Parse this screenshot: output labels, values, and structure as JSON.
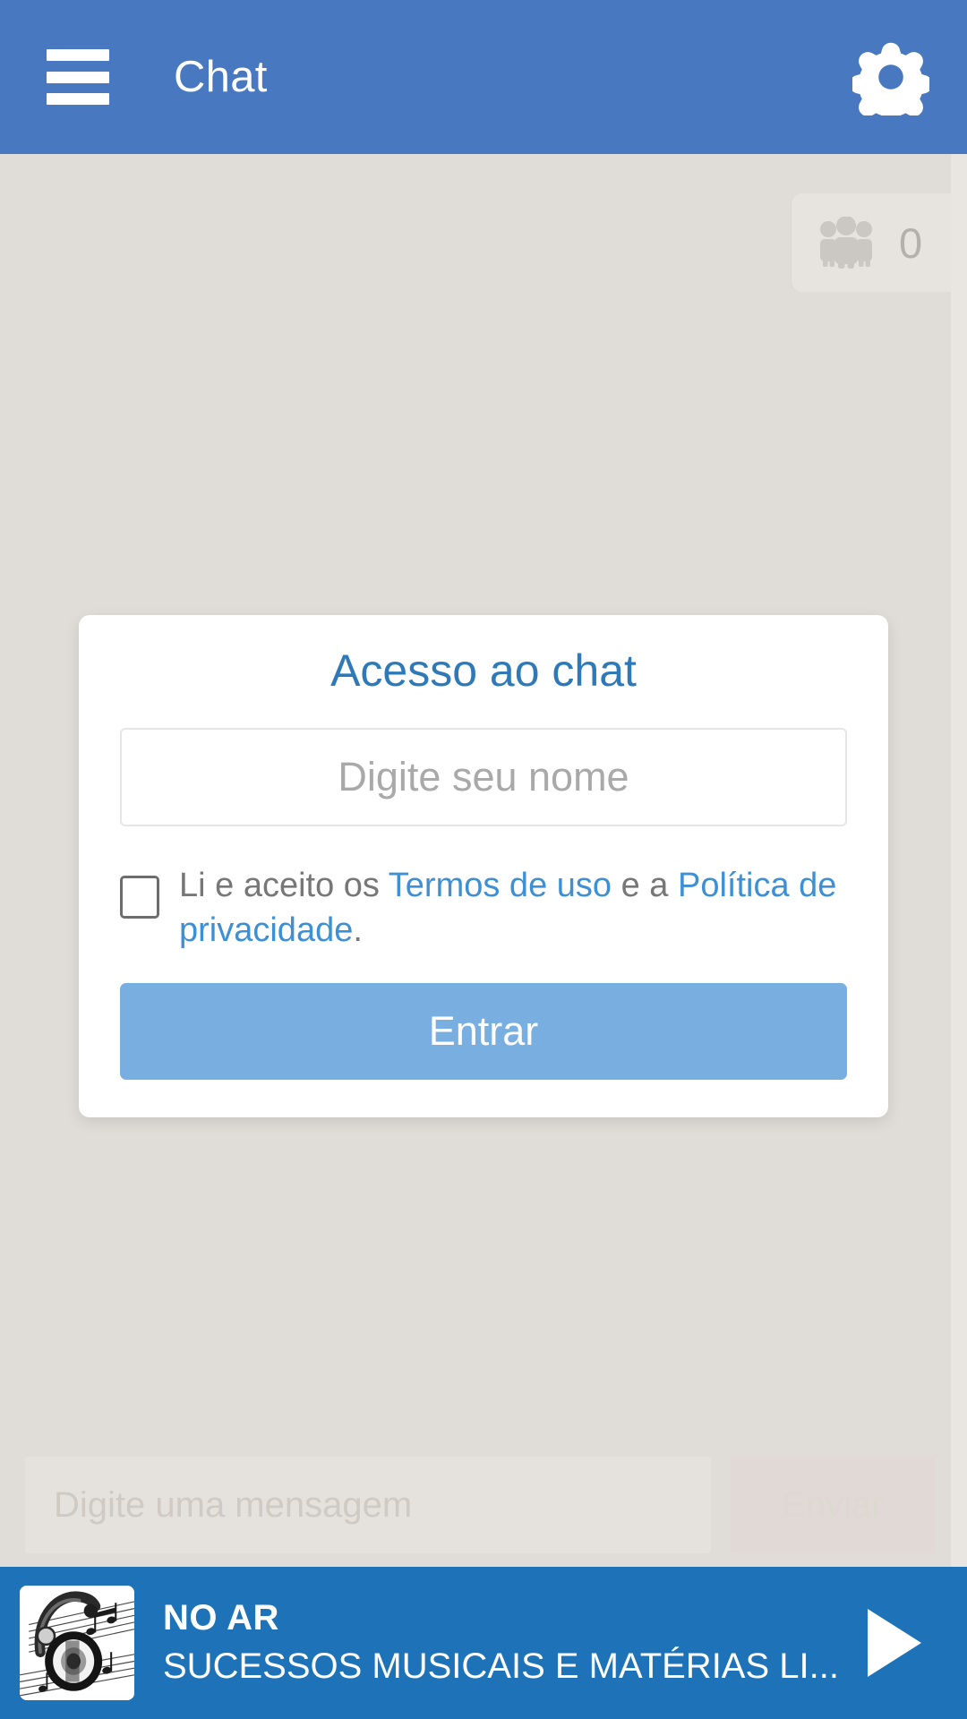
{
  "header": {
    "title": "Chat",
    "menu_icon": "hamburger-menu-icon",
    "settings_icon": "gear-icon"
  },
  "chat": {
    "viewers": {
      "icon": "people-group-icon",
      "count": "0"
    },
    "composer": {
      "placeholder": "Digite uma mensagem",
      "value": "",
      "send_label": "Enviar"
    }
  },
  "login_modal": {
    "title": "Acesso ao chat",
    "name_placeholder": "Digite seu nome",
    "name_value": "",
    "terms": {
      "prefix": "Li e aceito os ",
      "terms_link": "Termos de uso",
      "middle": " e a ",
      "privacy_link": "Política de privacidade",
      "suffix": "."
    },
    "submit_label": "Entrar"
  },
  "player": {
    "status_label": "NO AR",
    "program_title": "SUCESSOS MUSICAIS E MATÉRIAS LI...",
    "thumbnail": "headphones-sheet-music-thumbnail",
    "play_icon": "play-icon"
  },
  "colors": {
    "header_blue": "#4878bf",
    "player_blue": "#1d72b8",
    "accent_blue": "#3d8fd6",
    "title_blue": "#2e7ab8",
    "button_blue": "#78aee0",
    "page_background": "#e0dcd7",
    "card_white": "#ffffff"
  }
}
